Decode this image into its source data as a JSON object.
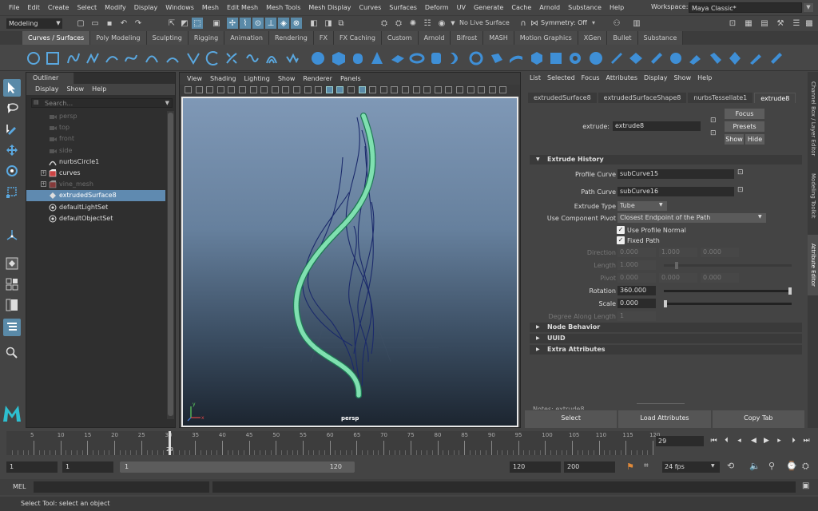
{
  "menubar": {
    "items": [
      "File",
      "Edit",
      "Create",
      "Select",
      "Modify",
      "Display",
      "Windows",
      "Mesh",
      "Edit Mesh",
      "Mesh Tools",
      "Mesh Display",
      "Curves",
      "Surfaces",
      "Deform",
      "UV",
      "Generate",
      "Cache",
      "Arnold",
      "Substance",
      "Help"
    ],
    "workspace_label": "Workspace:",
    "workspace_value": "Maya Classic*"
  },
  "statusline": {
    "mode": "Modeling",
    "live_surface": "No Live Surface",
    "symmetry": "Symmetry: Off"
  },
  "shelf_tabs": [
    "Curves / Surfaces",
    "Poly Modeling",
    "Sculpting",
    "Rigging",
    "Animation",
    "Rendering",
    "FX",
    "FX Caching",
    "Custom",
    "Arnold",
    "Bifrost",
    "MASH",
    "Motion Graphics",
    "XGen",
    "Bullet",
    "Substance"
  ],
  "shelf_active_tab": "Curves / Surfaces",
  "outliner": {
    "title": "Outliner",
    "menu": [
      "Display",
      "Show",
      "Help"
    ],
    "search_placeholder": "Search...",
    "rows": [
      {
        "label": "persp",
        "icon": "camera-icon",
        "dim": true
      },
      {
        "label": "top",
        "icon": "camera-icon",
        "dim": true
      },
      {
        "label": "front",
        "icon": "camera-icon",
        "dim": true
      },
      {
        "label": "side",
        "icon": "camera-icon",
        "dim": true
      },
      {
        "label": "nurbsCircle1",
        "icon": "curve-icon",
        "dim": false
      },
      {
        "label": "curves",
        "icon": "group-icon",
        "dim": false,
        "expand": true
      },
      {
        "label": "vine_mesh",
        "icon": "group-icon",
        "dim": true,
        "expand": true
      },
      {
        "label": "extrudedSurface8",
        "icon": "surface-icon",
        "dim": false,
        "selected": true
      },
      {
        "label": "defaultLightSet",
        "icon": "set-icon",
        "dim": false
      },
      {
        "label": "defaultObjectSet",
        "icon": "set-icon",
        "dim": false
      }
    ]
  },
  "viewport": {
    "menu": [
      "View",
      "Shading",
      "Lighting",
      "Show",
      "Renderer",
      "Panels"
    ],
    "camera_label": "persp",
    "axis_x": "x",
    "axis_y": "y"
  },
  "attribute_editor": {
    "menu": [
      "List",
      "Selected",
      "Focus",
      "Attributes",
      "Display",
      "Show",
      "Help"
    ],
    "tabs": [
      "extrudedSurface8",
      "extrudedSurfaceShape8",
      "nurbsTessellate1",
      "extrude8"
    ],
    "active_tab": "extrude8",
    "node_label": "extrude:",
    "node_value": "extrude8",
    "focus_button": "Focus",
    "presets_button": "Presets",
    "show_button": "Show",
    "hide_button": "Hide",
    "section_extrude": "Extrude History",
    "profile_curve_label": "Profile Curve",
    "profile_curve_value": "subCurve15",
    "path_curve_label": "Path Curve",
    "path_curve_value": "subCurve16",
    "extrude_type_label": "Extrude Type",
    "extrude_type_value": "Tube",
    "component_pivot_label": "Use Component Pivot",
    "component_pivot_value": "Closest Endpoint of the Path",
    "use_profile_normal": "Use Profile Normal",
    "fixed_path": "Fixed Path",
    "direction_label": "Direction",
    "direction_values": [
      "0.000",
      "1.000",
      "0.000"
    ],
    "length_label": "Length",
    "length_value": "1.000",
    "pivot_label": "Pivot",
    "pivot_values": [
      "0.000",
      "0.000",
      "0.000"
    ],
    "rotation_label": "Rotation",
    "rotation_value": "360.000",
    "rotation_fraction": 1.0,
    "scale_label": "Scale",
    "scale_value": "0.000",
    "scale_fraction": 0.0,
    "degree_label": "Degree Along Length",
    "degree_value": "1",
    "section_node_behavior": "Node Behavior",
    "section_uuid": "UUID",
    "section_extra": "Extra Attributes",
    "notes_label": "Notes:  extrude8",
    "select_button": "Select",
    "load_button": "Load Attributes",
    "copy_button": "Copy Tab"
  },
  "side_tabs": [
    "Channel Box / Layer Editor",
    "Modeling Toolkit",
    "Attribute Editor"
  ],
  "timeline": {
    "ticks": [
      "5",
      "10",
      "15",
      "20",
      "25",
      "30",
      "35",
      "40",
      "45",
      "50",
      "55",
      "60",
      "65",
      "70",
      "75",
      "80",
      "85",
      "90",
      "95",
      "100",
      "105",
      "110",
      "115",
      "120"
    ],
    "current_frame": "29",
    "frame_field": "29"
  },
  "range": {
    "start": "1",
    "playback_start": "1",
    "slider_start": "1",
    "slider_end": "120",
    "playback_end": "120",
    "end": "200",
    "fps": "24 fps"
  },
  "mel_label": "MEL",
  "help_text": "Select Tool: select an object",
  "colors": {
    "accent": "#5a8aa8",
    "selection": "#5f8ab0",
    "surface": "#7fe0b0",
    "curve": "#1b2a6b"
  }
}
